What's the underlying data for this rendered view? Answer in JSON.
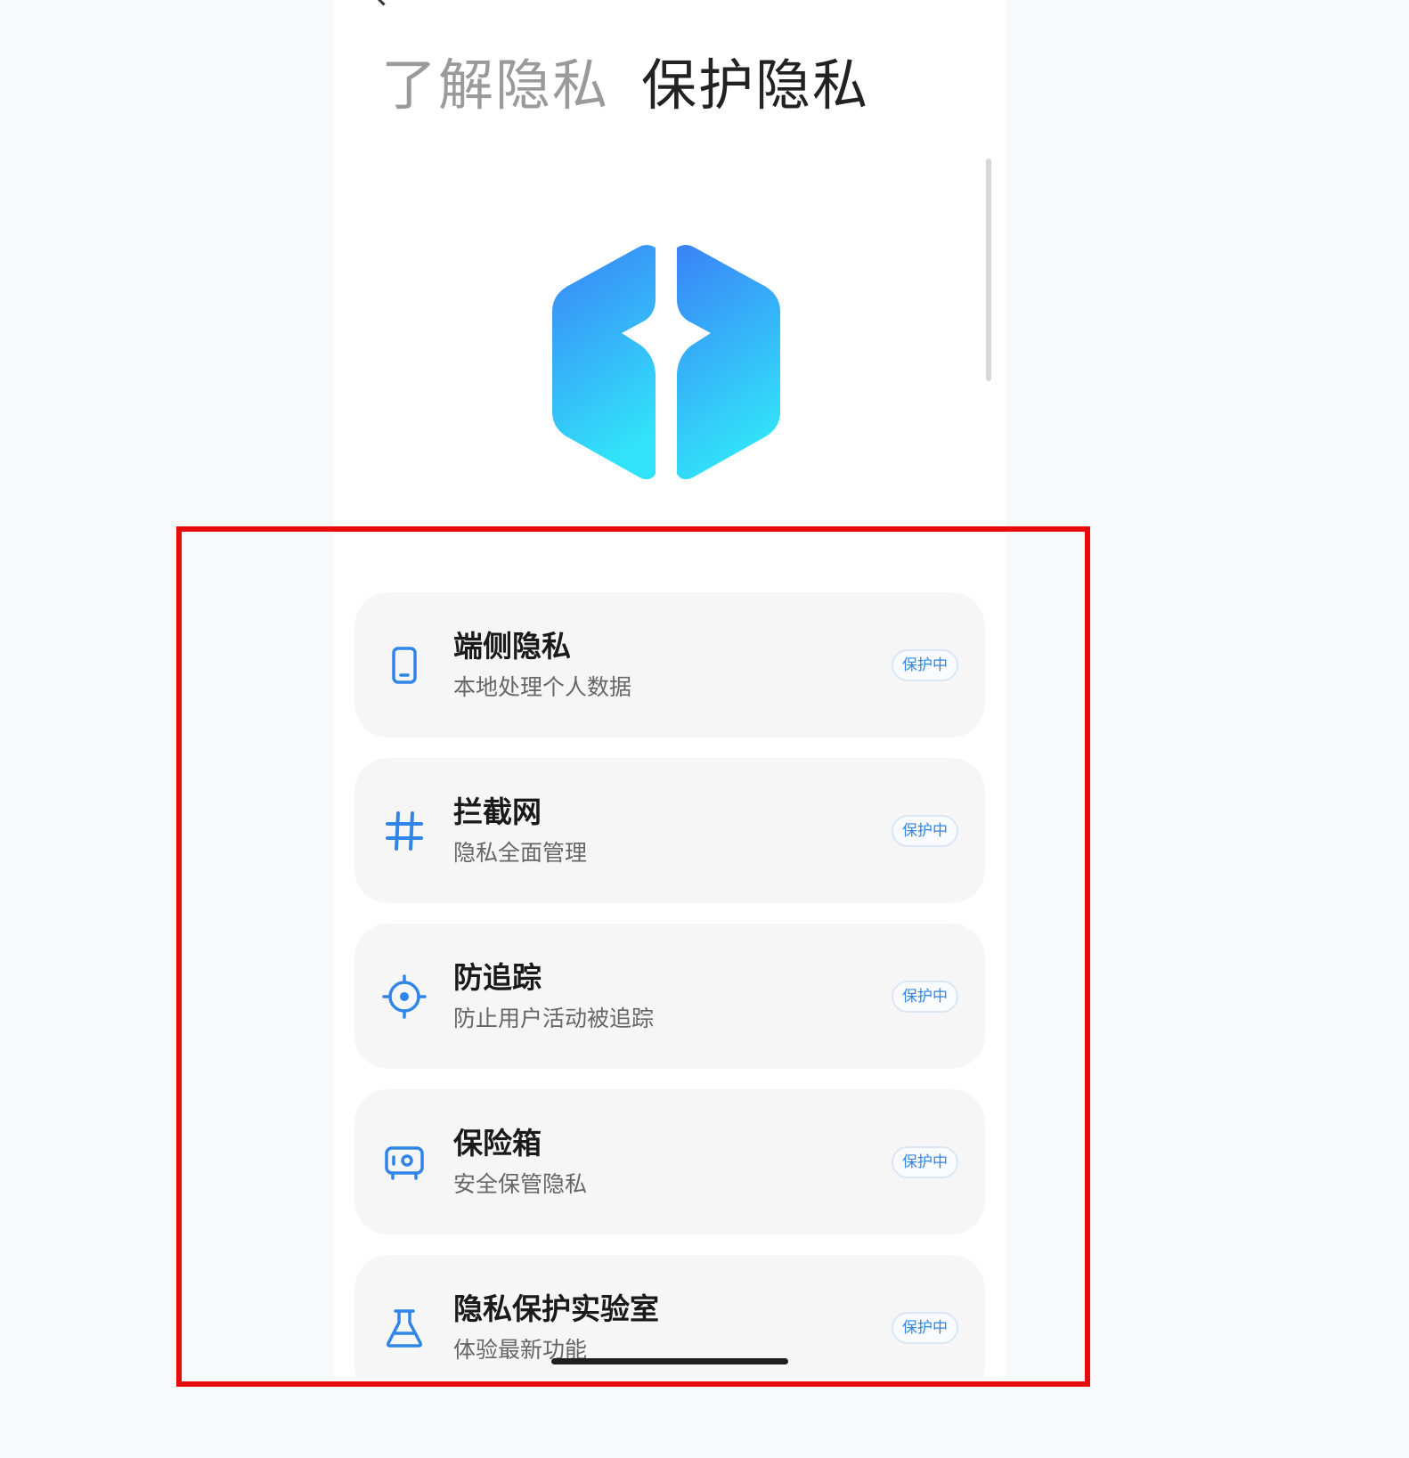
{
  "tabs": {
    "learn": "了解隐私",
    "protect": "保护隐私"
  },
  "colors": {
    "accent": "#2f86e8",
    "annotation": "#e70b0b"
  },
  "items": [
    {
      "icon": "phone-icon",
      "title": "端侧隐私",
      "subtitle": "本地处理个人数据",
      "badge": "保护中"
    },
    {
      "icon": "hashtag-icon",
      "title": "拦截网",
      "subtitle": "隐私全面管理",
      "badge": "保护中"
    },
    {
      "icon": "target-icon",
      "title": "防追踪",
      "subtitle": "防止用户活动被追踪",
      "badge": "保护中"
    },
    {
      "icon": "safe-box-icon",
      "title": "保险箱",
      "subtitle": "安全保管隐私",
      "badge": "保护中"
    },
    {
      "icon": "flask-icon",
      "title": "隐私保护实验室",
      "subtitle": "体验最新功能",
      "badge": "保护中"
    }
  ]
}
